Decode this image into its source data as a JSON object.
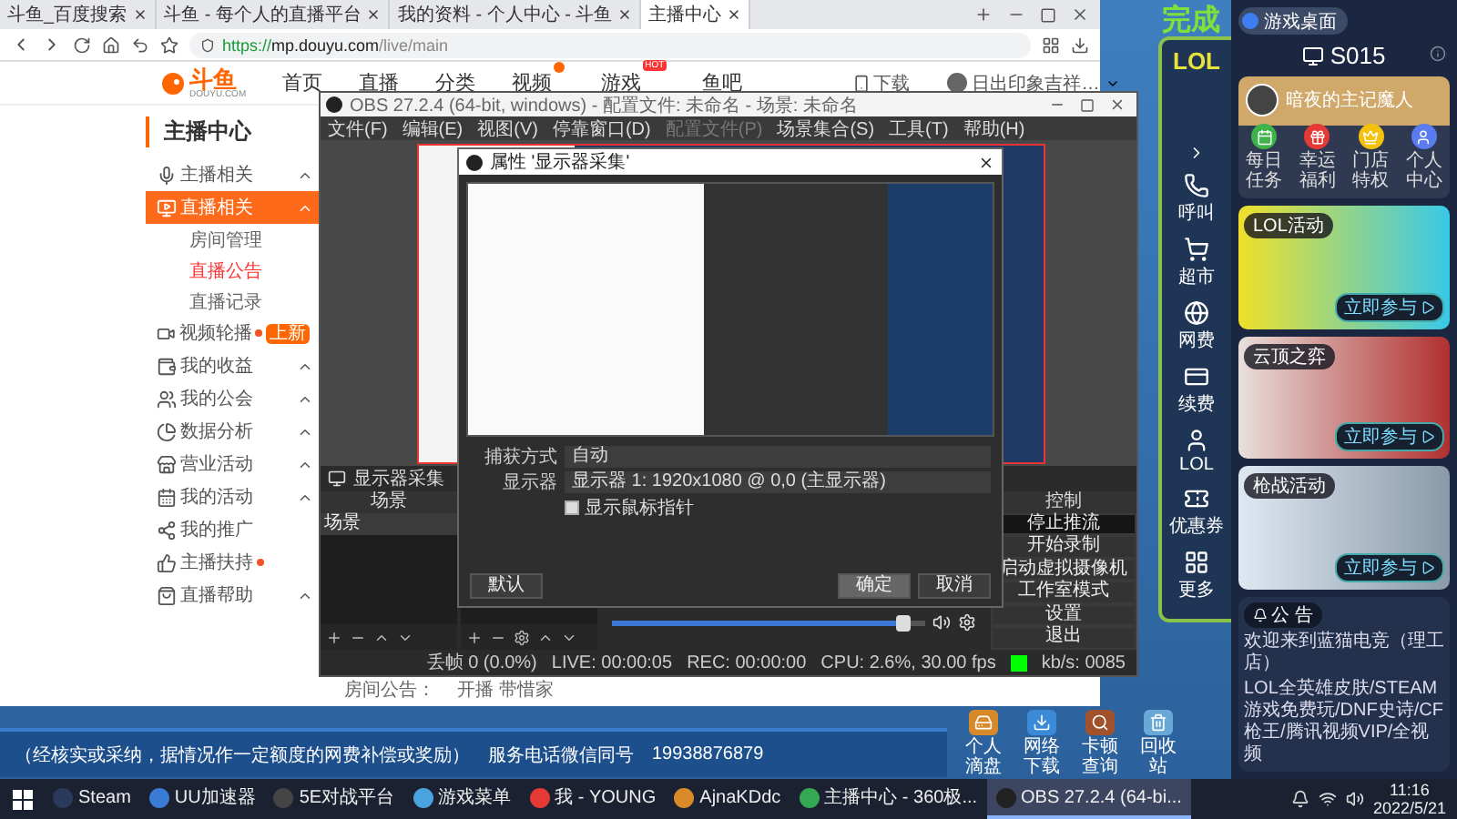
{
  "browser": {
    "tabs": [
      {
        "label": "斗鱼_百度搜索",
        "selected": false
      },
      {
        "label": "斗鱼 - 每个人的直播平台",
        "selected": false
      },
      {
        "label": "我的资料 - 个人中心 - 斗鱼",
        "selected": false
      },
      {
        "label": "主播中心",
        "selected": true
      }
    ],
    "address": {
      "scheme": "https://",
      "host": "mp.douyu.com",
      "path": "/live/main"
    },
    "site_nav": {
      "logo": "斗鱼",
      "logo_sub": "DOUYU.COM",
      "links": [
        {
          "label": "首页",
          "kind": "plain"
        },
        {
          "label": "直播",
          "kind": "plain"
        },
        {
          "label": "分类",
          "kind": "plain"
        },
        {
          "label": "视频",
          "kind": "dot"
        },
        {
          "label": "游戏",
          "kind": "tag",
          "tag": "HOT"
        },
        {
          "label": "鱼吧",
          "kind": "plain"
        }
      ],
      "download": "下载",
      "user": "日出印象吉祥…"
    },
    "sidebar": {
      "title": "主播中心",
      "items": [
        {
          "label": "主播相关",
          "selected": false,
          "expandable": true,
          "dot": false
        },
        {
          "label": "直播相关",
          "selected": true,
          "expandable": true,
          "dot": false,
          "children": [
            {
              "label": "房间管理",
              "selected": false
            },
            {
              "label": "直播公告",
              "selected": true
            },
            {
              "label": "直播记录",
              "selected": false
            }
          ]
        },
        {
          "label": "视频轮播",
          "selected": false,
          "expandable": false,
          "dot": true,
          "tag": "上新"
        },
        {
          "label": "我的收益",
          "selected": false,
          "expandable": true,
          "dot": false
        },
        {
          "label": "我的公会",
          "selected": false,
          "expandable": true,
          "dot": false
        },
        {
          "label": "数据分析",
          "selected": false,
          "expandable": true,
          "dot": false
        },
        {
          "label": "营业活动",
          "selected": false,
          "expandable": true,
          "dot": false
        },
        {
          "label": "我的活动",
          "selected": false,
          "expandable": true,
          "dot": false
        },
        {
          "label": "我的推广",
          "selected": false,
          "expandable": false,
          "dot": false
        },
        {
          "label": "主播扶持",
          "selected": false,
          "expandable": false,
          "dot": true
        },
        {
          "label": "直播帮助",
          "selected": false,
          "expandable": true,
          "dot": false
        }
      ]
    },
    "notice": {
      "label": "房间公告：",
      "value": "开播 带惜家"
    }
  },
  "obs": {
    "title": "OBS 27.2.4 (64-bit, windows) - 配置文件: 未命名 - 场景: 未命名",
    "menu": [
      {
        "label": "文件(F)",
        "disabled": false
      },
      {
        "label": "编辑(E)",
        "disabled": false
      },
      {
        "label": "视图(V)",
        "disabled": false
      },
      {
        "label": "停靠窗口(D)",
        "disabled": false
      },
      {
        "label": "配置文件(P)",
        "disabled": true
      },
      {
        "label": "场景集合(S)",
        "disabled": false
      },
      {
        "label": "工具(T)",
        "disabled": false
      },
      {
        "label": "帮助(H)",
        "disabled": false
      }
    ],
    "dialog": {
      "title": "属性 '显示器采集'",
      "fields": [
        {
          "label": "捕获方式",
          "value": "自动"
        },
        {
          "label": "显示器",
          "value": "显示器 1: 1920x1080 @ 0,0 (主显示器)"
        }
      ],
      "checkbox": {
        "label": "显示鼠标指针",
        "checked": true
      },
      "buttons": [
        {
          "label": "默认",
          "hovered": false
        },
        {
          "label": "确定",
          "hovered": true
        },
        {
          "label": "取消",
          "hovered": false
        }
      ]
    },
    "source_label": "显示器采集",
    "scenes": {
      "title": "场景",
      "items": [
        {
          "label": "场景",
          "selected": true
        }
      ]
    },
    "mixer": {
      "level": 0.93
    },
    "controls": {
      "title": "控制",
      "buttons": [
        {
          "label": "停止推流",
          "active": true
        },
        {
          "label": "开始录制",
          "active": false
        },
        {
          "label": "启动虚拟摄像机",
          "active": false
        },
        {
          "label": "工作室模式",
          "active": false
        },
        {
          "label": "设置",
          "active": false
        },
        {
          "label": "退出",
          "active": false
        }
      ]
    },
    "status": [
      "丢帧 0 (0.0%)",
      "LIVE: 00:00:05",
      "REC: 00:00:00",
      "CPU: 2.6%, 30.00 fps",
      "kb/s: 0085"
    ]
  },
  "desktop": {
    "headline": "完成",
    "banner": {
      "note": "（经核实或采纳，据情况作一定额度的网费补偿或奖励）",
      "phone_label": "服务电话微信同号",
      "phone": "19938876879"
    },
    "icons": [
      "个人滴盘",
      "网络下载",
      "卡顿查询",
      "回收站"
    ]
  },
  "launcher": {
    "game": "LOL",
    "items": [
      "呼叫",
      "超市",
      "网费",
      "续费",
      "LOL",
      "优惠券",
      "更多"
    ]
  },
  "game_panel": {
    "desktop_button": "游戏桌面",
    "seat": "S015",
    "user": "暗夜的主记魔人",
    "actions": [
      "每日任务",
      "幸运福利",
      "门店特权",
      "个人中心"
    ],
    "cards": [
      {
        "tag": "LOL活动",
        "button": "立即参与"
      },
      {
        "tag": "云顶之弈",
        "button": "立即参与"
      },
      {
        "tag": "枪战活动",
        "button": "立即参与"
      }
    ],
    "announcement": {
      "title": "公 告",
      "lines": [
        "欢迎来到蓝猫电竞（理工店）",
        "LOL全英雄皮肤/STEAM游戏免费玩/DNF史诗/CF枪王/腾讯视频VIP/全视频"
      ]
    }
  },
  "taskbar": {
    "items": [
      {
        "label": "Steam",
        "selected": false
      },
      {
        "label": "UU加速器",
        "selected": false
      },
      {
        "label": "5E对战平台",
        "selected": false
      },
      {
        "label": "游戏菜单",
        "selected": false
      },
      {
        "label": "我 - YOUNG",
        "selected": false
      },
      {
        "label": "AjnaKDdc",
        "selected": false
      },
      {
        "label": "主播中心 - 360极...",
        "selected": false
      },
      {
        "label": "OBS 27.2.4 (64-bi...",
        "selected": true
      }
    ],
    "time": "11:16",
    "date": "2022/5/21"
  }
}
